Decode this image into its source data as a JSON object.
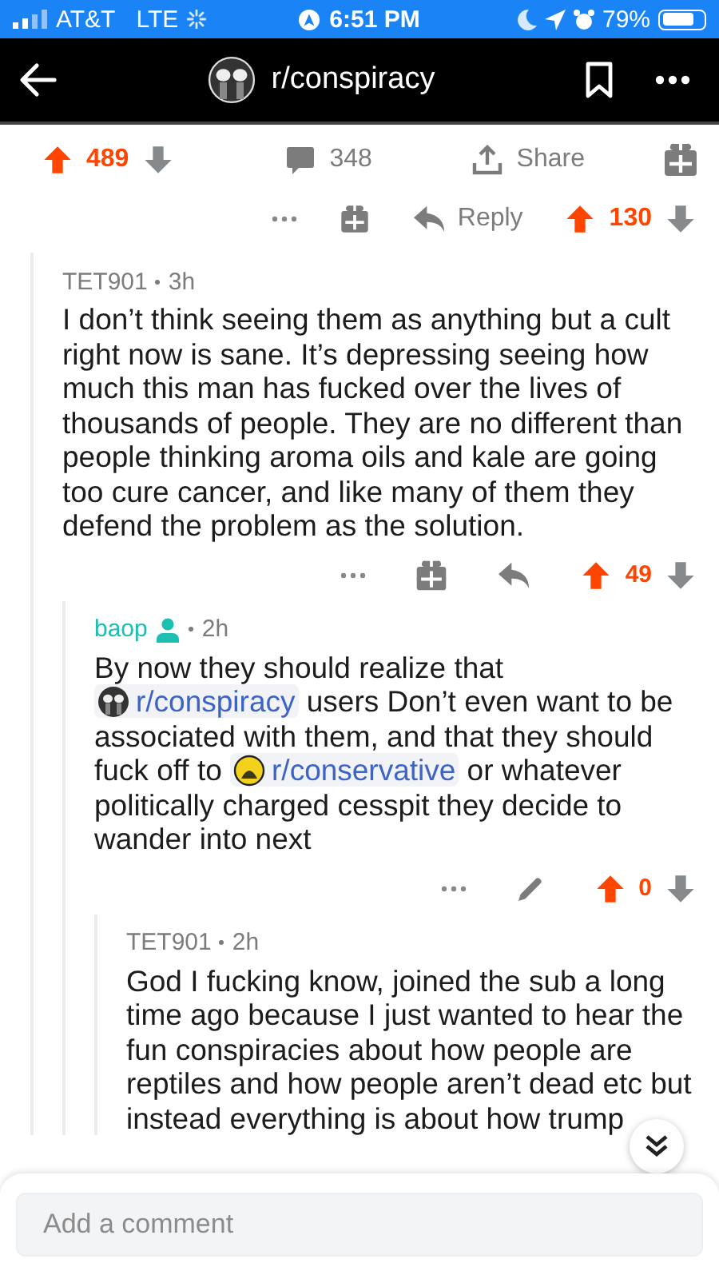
{
  "status_bar": {
    "carrier": "AT&T",
    "network": "LTE",
    "time": "6:51 PM",
    "battery": "79%"
  },
  "header": {
    "title": "r/conspiracy"
  },
  "post_actions": {
    "upvoted": true,
    "score": "489",
    "comments": "348",
    "share": "Share"
  },
  "parent_comment_actions": {
    "reply": "Reply",
    "upvoted": true,
    "score": "130"
  },
  "comments": [
    {
      "kind": "other",
      "author": "TET901",
      "age": "3h",
      "body": [
        {
          "kind": "text",
          "text": "I don’t think seeing them as anything but a cult right now is sane. It’s depressing seeing how much this man has fucked over the lives of thousands of people. They are no different than people thinking aroma oils and kale are going too cure cancer, and like many of them they defend the problem as the solution."
        }
      ],
      "actions": {
        "upvoted": true,
        "score": "49"
      },
      "children": [
        {
          "kind": "own",
          "author": "baop",
          "age": "2h",
          "body": [
            {
              "kind": "text",
              "text": "By now they should realize that "
            },
            {
              "kind": "link",
              "text": "r/conspiracy"
            },
            {
              "kind": "text",
              "text": " users Don’t even want to be associated with them, and that they should fuck off to "
            },
            {
              "kind": "link",
              "text": "r/conservative"
            },
            {
              "kind": "text",
              "text": " or whatever politically charged cesspit they decide to wander into next"
            }
          ],
          "actions": {
            "upvoted": true,
            "score": "0"
          },
          "children": [
            {
              "kind": "other",
              "author": "TET901",
              "age": "2h",
              "body": [
                {
                  "kind": "text",
                  "text": "God I fucking know,  joined the sub a long time ago because I just wanted to hear the fun conspiracies about how people are reptiles and how people aren’t dead etc but instead everything is about how trump"
                }
              ]
            }
          ]
        }
      ]
    }
  ],
  "comment_box": {
    "placeholder": "Add a comment"
  }
}
